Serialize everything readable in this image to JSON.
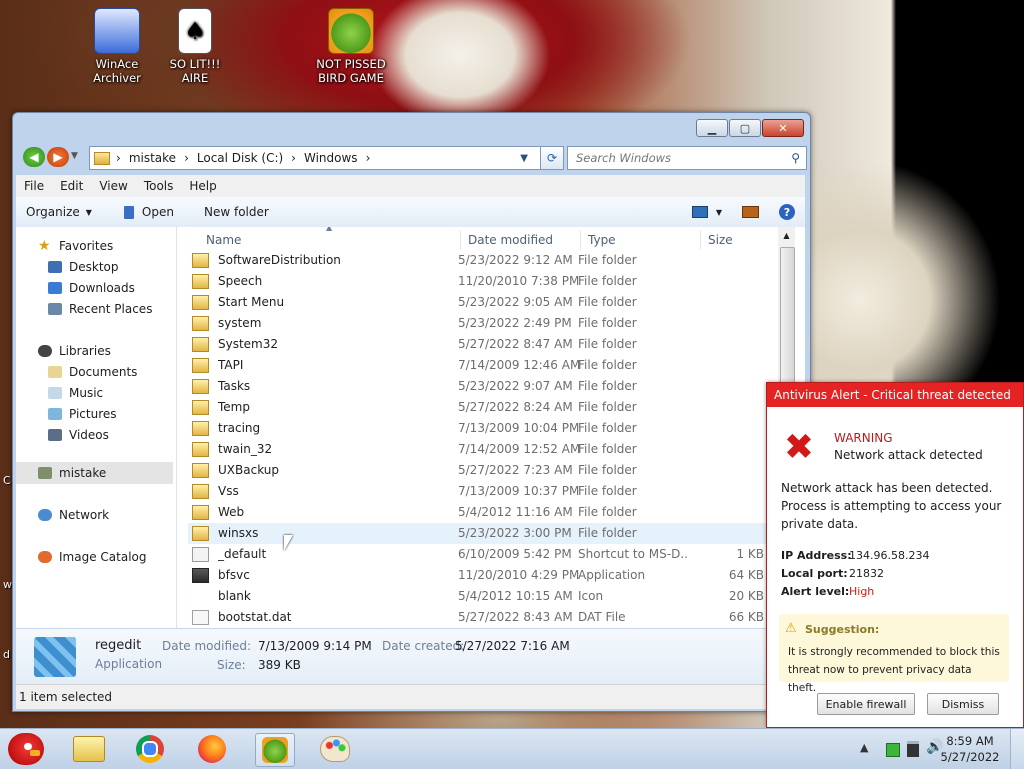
{
  "desktop": {
    "icons": [
      {
        "label_line1": "WinAce",
        "label_line2": "Archiver",
        "icon": "archive-icon"
      },
      {
        "label_line1": "SO LIT!!! AIRE",
        "label_line2": "",
        "icon": "solitaire-card-icon"
      },
      {
        "label_line1": "NOT PISSED",
        "label_line2": "BIRD GAME",
        "icon": "green-pig-icon"
      }
    ],
    "edge_letters": [
      "C",
      "w",
      "d"
    ]
  },
  "explorer": {
    "address": [
      "mistake",
      "Local Disk (C:)",
      "Windows"
    ],
    "search_placeholder": "Search Windows",
    "menu": [
      "File",
      "Edit",
      "View",
      "Tools",
      "Help"
    ],
    "toolbar": {
      "organize": "Organize",
      "open": "Open",
      "new_folder": "New folder"
    },
    "nav": {
      "favorites": "Favorites",
      "favorites_items": [
        "Desktop",
        "Downloads",
        "Recent Places"
      ],
      "libraries": "Libraries",
      "libraries_items": [
        "Documents",
        "Music",
        "Pictures",
        "Videos"
      ],
      "homegroup": "mistake",
      "network": "Network",
      "image_catalog": "Image Catalog"
    },
    "columns": {
      "name": "Name",
      "date": "Date modified",
      "type": "Type",
      "size": "Size"
    },
    "rows": [
      {
        "name": "SoftwareDistribution",
        "date": "5/23/2022 9:12 AM",
        "type": "File folder",
        "size": "",
        "kind": "folder"
      },
      {
        "name": "Speech",
        "date": "11/20/2010 7:38 PM",
        "type": "File folder",
        "size": "",
        "kind": "folder"
      },
      {
        "name": "Start Menu",
        "date": "5/23/2022 9:05 AM",
        "type": "File folder",
        "size": "",
        "kind": "folder"
      },
      {
        "name": "system",
        "date": "5/23/2022 2:49 PM",
        "type": "File folder",
        "size": "",
        "kind": "folder"
      },
      {
        "name": "System32",
        "date": "5/27/2022 8:47 AM",
        "type": "File folder",
        "size": "",
        "kind": "folder"
      },
      {
        "name": "TAPI",
        "date": "7/14/2009 12:46 AM",
        "type": "File folder",
        "size": "",
        "kind": "folder"
      },
      {
        "name": "Tasks",
        "date": "5/23/2022 9:07 AM",
        "type": "File folder",
        "size": "",
        "kind": "folder"
      },
      {
        "name": "Temp",
        "date": "5/27/2022 8:24 AM",
        "type": "File folder",
        "size": "",
        "kind": "folder"
      },
      {
        "name": "tracing",
        "date": "7/13/2009 10:04 PM",
        "type": "File folder",
        "size": "",
        "kind": "folder"
      },
      {
        "name": "twain_32",
        "date": "7/14/2009 12:52 AM",
        "type": "File folder",
        "size": "",
        "kind": "folder"
      },
      {
        "name": "UXBackup",
        "date": "5/27/2022 7:23 AM",
        "type": "File folder",
        "size": "",
        "kind": "folder"
      },
      {
        "name": "Vss",
        "date": "7/13/2009 10:37 PM",
        "type": "File folder",
        "size": "",
        "kind": "folder"
      },
      {
        "name": "Web",
        "date": "5/4/2012 11:16 AM",
        "type": "File folder",
        "size": "",
        "kind": "folder"
      },
      {
        "name": "winsxs",
        "date": "5/23/2022 3:00 PM",
        "type": "File folder",
        "size": "",
        "kind": "folder",
        "selected": true
      },
      {
        "name": "_default",
        "date": "6/10/2009 5:42 PM",
        "type": "Shortcut to MS-D...",
        "size": "1 KB",
        "kind": "shortcut"
      },
      {
        "name": "bfsvc",
        "date": "11/20/2010 4:29 PM",
        "type": "Application",
        "size": "64 KB",
        "kind": "app"
      },
      {
        "name": "blank",
        "date": "5/4/2012 10:15 AM",
        "type": "Icon",
        "size": "20 KB",
        "kind": "blank"
      },
      {
        "name": "bootstat.dat",
        "date": "5/27/2022 8:43 AM",
        "type": "DAT File",
        "size": "66 KB",
        "kind": "file"
      }
    ],
    "details": {
      "name": "regedit",
      "kind": "Application",
      "modified_label": "Date modified:",
      "modified": "7/13/2009 9:14 PM",
      "created_label": "Date created:",
      "created": "5/27/2022 7:16 AM",
      "size_label": "Size:",
      "size": "389 KB"
    },
    "status": "1 item selected"
  },
  "antivirus": {
    "title": "Antivirus Alert - Critical threat detected",
    "warning": "WARNING",
    "subtitle": "Network attack detected",
    "message": "Network attack has been detected. Process is attempting to access your private data.",
    "ip_label": "IP Address:",
    "ip": "134.96.58.234",
    "port_label": "Local port:",
    "port": "21832",
    "level_label": "Alert level:",
    "level": "High",
    "suggestion_label": "Suggestion:",
    "suggestion": "It is strongly recommended to block this threat now to prevent privacy data theft.",
    "enable": "Enable firewall",
    "dismiss": "Dismiss",
    "accent": "#e52323"
  },
  "taskbar": {
    "time": "8:59 AM",
    "date": "5/27/2022"
  }
}
